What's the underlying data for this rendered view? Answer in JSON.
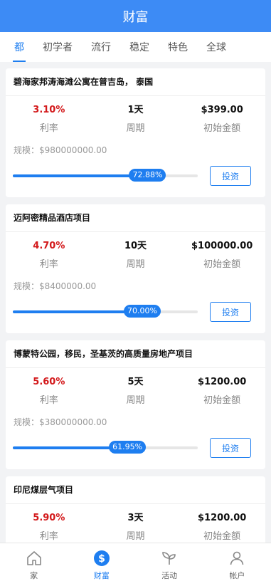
{
  "header": {
    "title": "财富"
  },
  "tabs": [
    {
      "label": "都",
      "active": true
    },
    {
      "label": "初学者",
      "active": false
    },
    {
      "label": "流行",
      "active": false
    },
    {
      "label": "稳定",
      "active": false
    },
    {
      "label": "特色",
      "active": false
    },
    {
      "label": "全球",
      "active": false
    }
  ],
  "labels": {
    "rate": "利率",
    "period": "周期",
    "initial": "初始金额",
    "invest": "投资"
  },
  "projects": [
    {
      "title": "碧海家邦涛海滩公寓在普吉岛， 泰国",
      "rate": "3.10%",
      "period": "1天",
      "amount": "$399.00",
      "scale": "规模：$980000000.00",
      "progress_label": "72.88%",
      "progress": 0.7288
    },
    {
      "title": "迈阿密精品酒店项目",
      "rate": "4.70%",
      "period": "10天",
      "amount": "$100000.00",
      "scale": "规模：$8400000.00",
      "progress_label": "70.00%",
      "progress": 0.7
    },
    {
      "title": "博蒙特公园，移民，圣基茨的高质量房地产项目",
      "rate": "5.60%",
      "period": "5天",
      "amount": "$1200.00",
      "scale": "规模：$380000000.00",
      "progress_label": "61.95%",
      "progress": 0.6195
    },
    {
      "title": "印尼煤层气项目",
      "rate": "5.90%",
      "period": "3天",
      "amount": "$1200.00",
      "scale": "",
      "progress_label": "",
      "progress": null
    }
  ],
  "bottom_nav": [
    {
      "label": "家",
      "icon": "home-icon",
      "active": false
    },
    {
      "label": "财富",
      "icon": "dollar-icon",
      "active": true
    },
    {
      "label": "活动",
      "icon": "sprout-icon",
      "active": false
    },
    {
      "label": "帐户",
      "icon": "user-icon",
      "active": false
    }
  ],
  "colors": {
    "header": "#3d8bf5",
    "accent": "#1e7ef0",
    "rate": "#d3191b"
  }
}
